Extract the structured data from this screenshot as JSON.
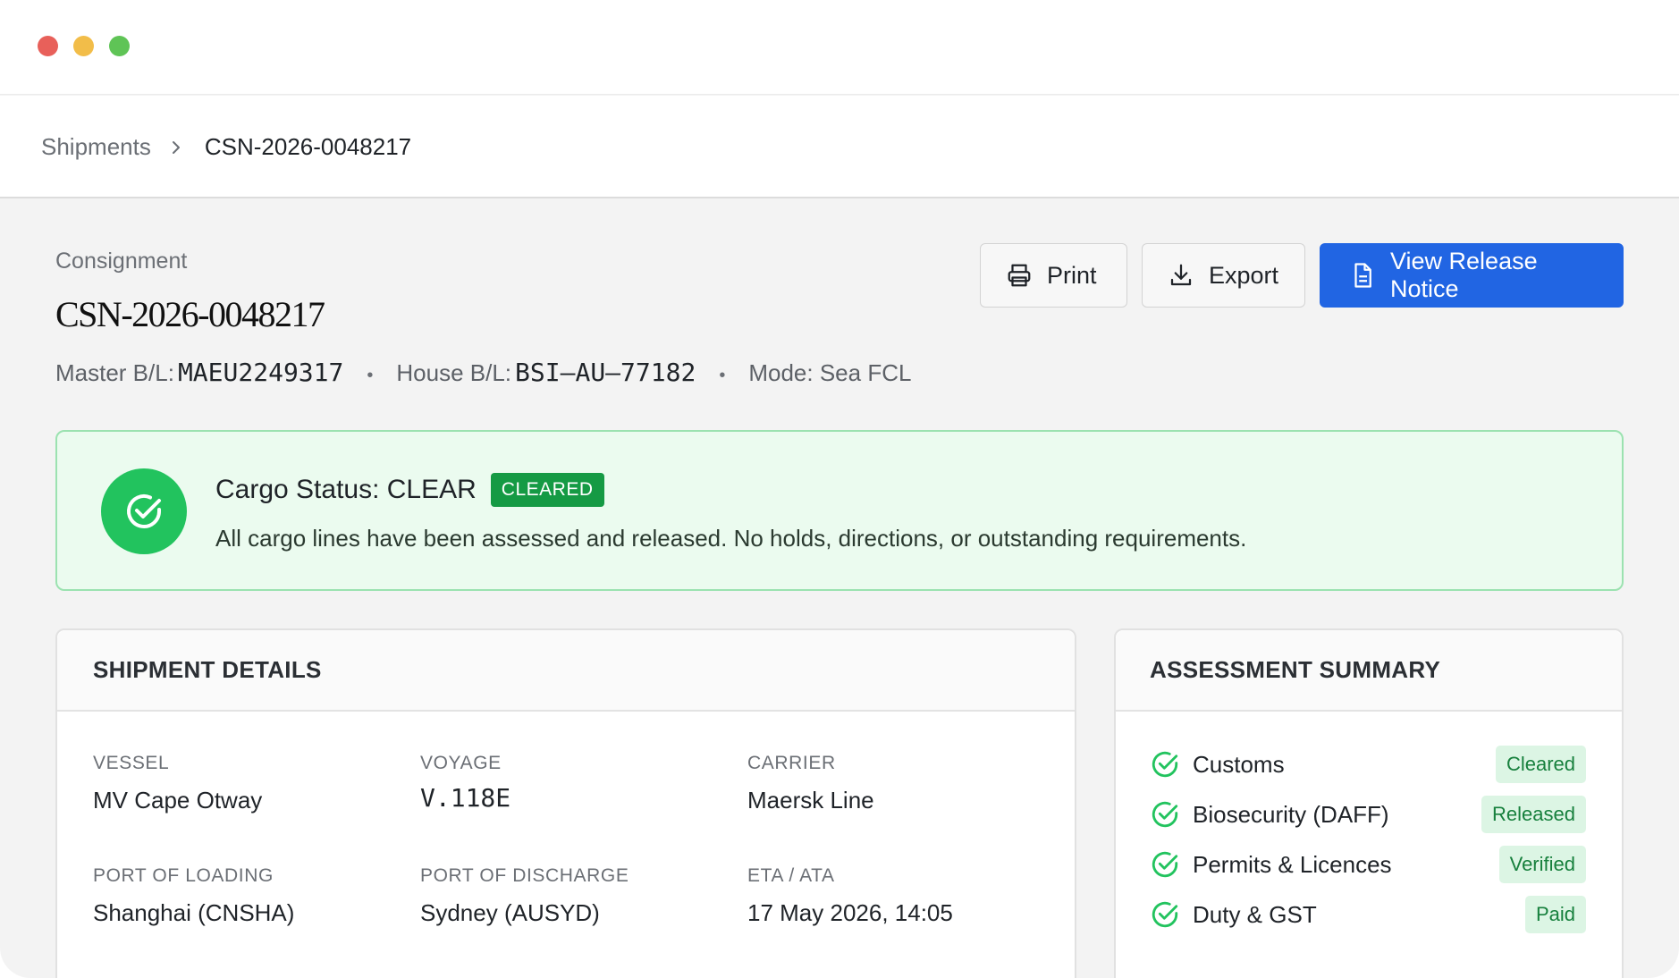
{
  "breadcrumb": {
    "parent": "Shipments",
    "current": "CSN-2026-0048217"
  },
  "header": {
    "eyebrow": "Consignment",
    "title": "CSN-2026-0048217",
    "master_bl_label": "Master B/L:",
    "master_bl_value": "MAEU2249317",
    "house_bl_label": "House B/L:",
    "house_bl_value": "BSI–AU–77182",
    "mode": "Mode: Sea FCL",
    "separator": "•"
  },
  "actions": {
    "print_label": "Print",
    "export_label": "Export",
    "release_label": "View Release Notice"
  },
  "status": {
    "title": "Cargo Status: CLEAR",
    "badge": "CLEARED",
    "description": "All cargo lines have been assessed and released. No holds, directions, or outstanding requirements."
  },
  "shipment_details": {
    "heading": "SHIPMENT DETAILS",
    "fields": [
      {
        "label": "VESSEL",
        "value": "MV Cape Otway"
      },
      {
        "label": "VOYAGE",
        "value": "V.118E"
      },
      {
        "label": "CARRIER",
        "value": "Maersk Line"
      },
      {
        "label": "PORT OF LOADING",
        "value": "Shanghai (CNSHA)"
      },
      {
        "label": "PORT OF DISCHARGE",
        "value": "Sydney (AUSYD)"
      },
      {
        "label": "ETA / ATA",
        "value": "17 May 2026, 14:05"
      }
    ]
  },
  "assessment_summary": {
    "heading": "ASSESSMENT SUMMARY",
    "items": [
      {
        "name": "Customs",
        "status": "Cleared"
      },
      {
        "name": "Biosecurity (DAFF)",
        "status": "Released"
      },
      {
        "name": "Permits & Licences",
        "status": "Verified"
      },
      {
        "name": "Duty & GST",
        "status": "Paid"
      }
    ]
  },
  "colors": {
    "primary": "#2165e3",
    "success": "#22c35e",
    "success_dark": "#159a44",
    "success_bg": "#ebfbef"
  },
  "icons": [
    "chevron-right-icon",
    "printer-icon",
    "download-icon",
    "document-icon",
    "check-circle-icon"
  ]
}
